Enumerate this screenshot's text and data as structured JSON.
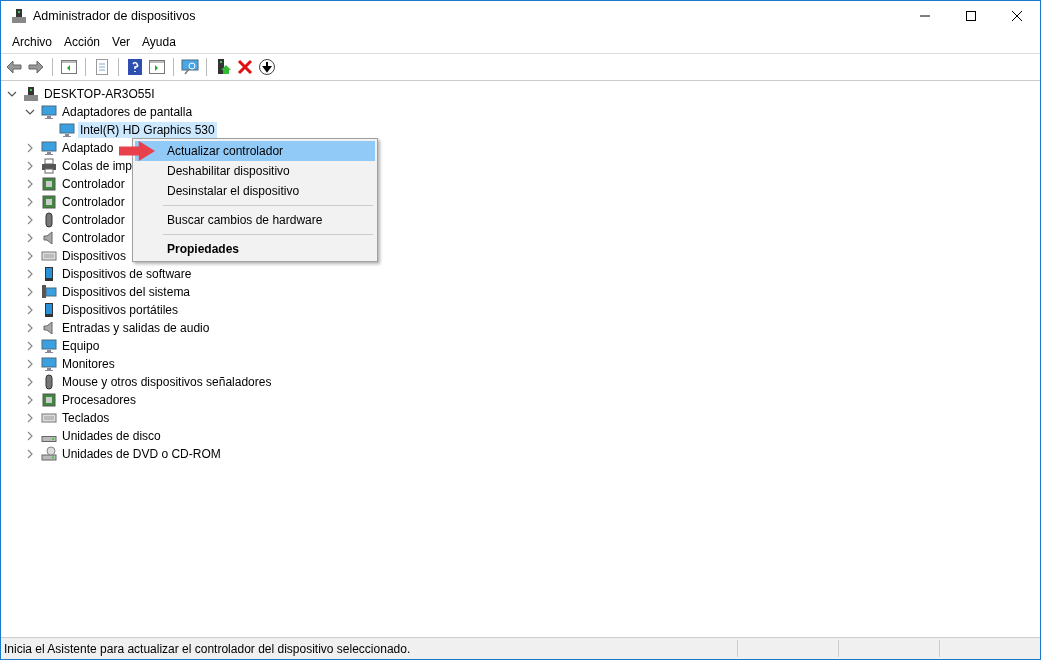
{
  "window": {
    "title": "Administrador de dispositivos"
  },
  "menu_bar": [
    "Archivo",
    "Acción",
    "Ver",
    "Ayuda"
  ],
  "tree": {
    "label": "DESKTOP-AR3O55I",
    "expanded": true,
    "selected": false,
    "children": [
      {
        "label": "Adaptadores de pantalla",
        "expanded": true,
        "selected": false,
        "children": [
          {
            "label": "Intel(R) HD Graphics 530",
            "selected": true
          }
        ]
      },
      {
        "label": "Adaptado",
        "expanded": false,
        "selected": false
      },
      {
        "label": "Colas de imp",
        "expanded": false,
        "selected": false
      },
      {
        "label": "Controlador",
        "expanded": false,
        "selected": false
      },
      {
        "label": "Controlador",
        "expanded": false,
        "selected": false
      },
      {
        "label": "Controlador",
        "expanded": false,
        "selected": false
      },
      {
        "label": "Controlador",
        "expanded": false,
        "selected": false
      },
      {
        "label": "Dispositivos",
        "expanded": false,
        "selected": false
      },
      {
        "label": "Dispositivos de software",
        "expanded": false,
        "selected": false
      },
      {
        "label": "Dispositivos del sistema",
        "expanded": false,
        "selected": false
      },
      {
        "label": "Dispositivos portátiles",
        "expanded": false,
        "selected": false
      },
      {
        "label": "Entradas y salidas de audio",
        "expanded": false,
        "selected": false
      },
      {
        "label": "Equipo",
        "expanded": false,
        "selected": false
      },
      {
        "label": "Monitores",
        "expanded": false,
        "selected": false
      },
      {
        "label": "Mouse y otros dispositivos señaladores",
        "expanded": false,
        "selected": false
      },
      {
        "label": "Procesadores",
        "expanded": false,
        "selected": false
      },
      {
        "label": "Teclados",
        "expanded": false,
        "selected": false
      },
      {
        "label": "Unidades de disco",
        "expanded": false,
        "selected": false
      },
      {
        "label": "Unidades de DVD o CD-ROM",
        "expanded": false,
        "selected": false
      }
    ]
  },
  "context_menu": [
    {
      "kind": "item",
      "label": "Actualizar controlador",
      "selected": true,
      "default": false
    },
    {
      "kind": "item",
      "label": "Deshabilitar dispositivo",
      "selected": false,
      "default": false
    },
    {
      "kind": "item",
      "label": "Desinstalar el dispositivo",
      "selected": false,
      "default": false
    },
    {
      "kind": "separator"
    },
    {
      "kind": "item",
      "label": "Buscar cambios de hardware",
      "selected": false,
      "default": false
    },
    {
      "kind": "separator"
    },
    {
      "kind": "item",
      "label": "Propiedades",
      "selected": false,
      "default": true
    }
  ],
  "status_bar": {
    "text": "Inicia el Asistente para actualizar el controlador del dispositivo seleccionado."
  }
}
